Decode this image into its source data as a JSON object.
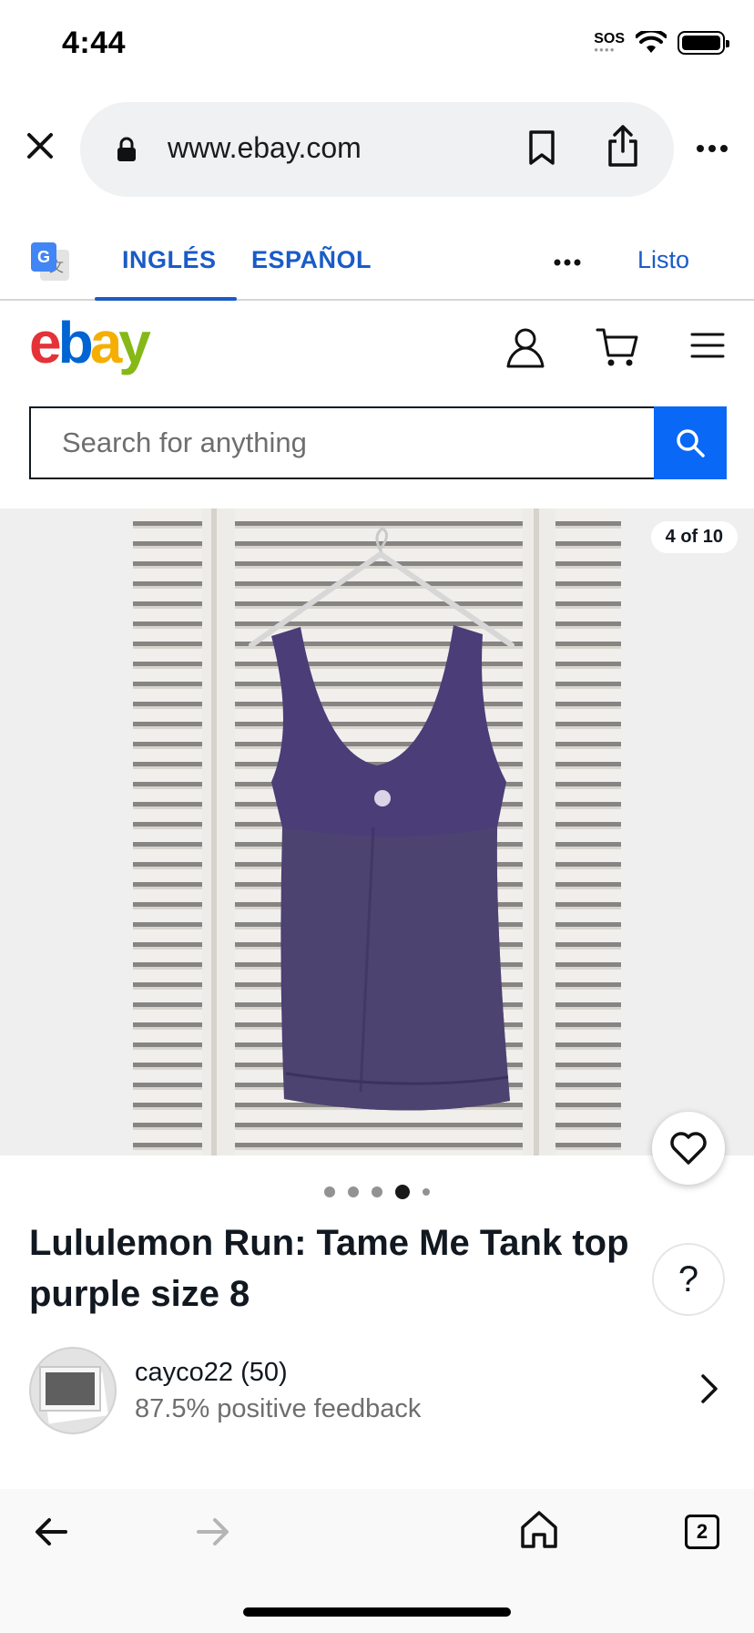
{
  "status_bar": {
    "time": "4:44",
    "sos_label": "SOS"
  },
  "browser": {
    "url": "www.ebay.com"
  },
  "translate": {
    "tab_english": "INGLÉS",
    "tab_spanish": "ESPAÑOL",
    "done_label": "Listo",
    "active_tab": "INGLÉS"
  },
  "ebay": {
    "logo": {
      "e": "e",
      "b": "b",
      "a": "a",
      "y": "y"
    },
    "search_placeholder": "Search for anything"
  },
  "listing": {
    "photo_counter": "4 of 10",
    "photo_index": 4,
    "photo_total": 10,
    "title": "Lululemon Run: Tame Me Tank top purple size 8",
    "seller_name": "cayco22 (50)",
    "seller_feedback": "87.5% positive feedback",
    "help_label": "?"
  },
  "toolbar": {
    "tab_count": "2"
  },
  "colors": {
    "accent_blue": "#1a5bc7",
    "search_button": "#0968f6",
    "garment_purple": "#4a3d78"
  }
}
